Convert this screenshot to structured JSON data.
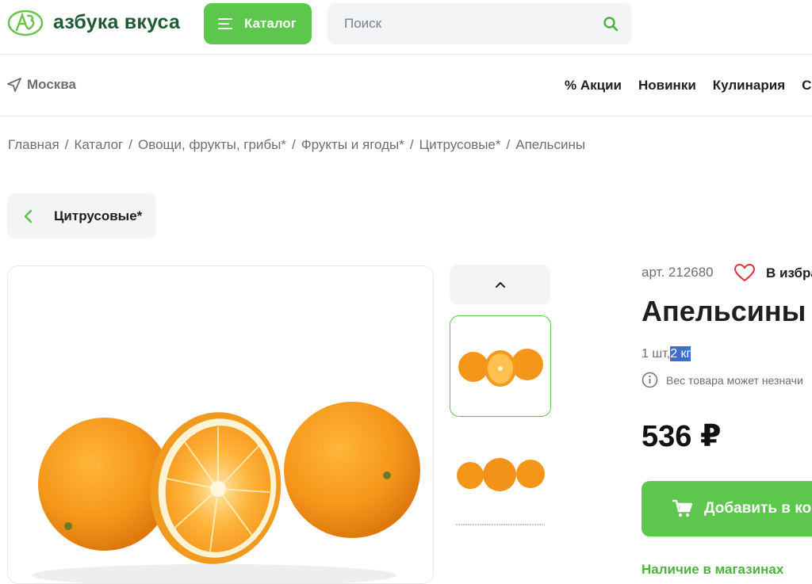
{
  "header": {
    "logo_text": "азбука вкуса",
    "catalog_label": "Каталог",
    "search_placeholder": "Поиск"
  },
  "location": {
    "city": "Москва"
  },
  "nav": {
    "items": [
      "% Акции",
      "Новинки",
      "Кулинария",
      "Со"
    ]
  },
  "breadcrumbs": [
    "Главная",
    "Каталог",
    "Овощи, фрукты, грибы*",
    "Фрукты и ягоды*",
    "Цитрусовые*",
    "Апельсины"
  ],
  "back": {
    "label": "Цитрусовые*"
  },
  "product": {
    "article": "арт. 212680",
    "favorite_label": "В избра",
    "title": "Апельсины",
    "unit_prefix": "1 шт,",
    "unit_weight": "2 кг",
    "weight_note": "Вес товара может незначи",
    "price": "536 ₽",
    "add_to_cart": "Добавить в ко",
    "availability": "Наличие в магазинах"
  },
  "colors": {
    "brand_green": "#5cc64d",
    "logo_green": "#1e5a33",
    "selection_blue": "#3b6fd4"
  }
}
